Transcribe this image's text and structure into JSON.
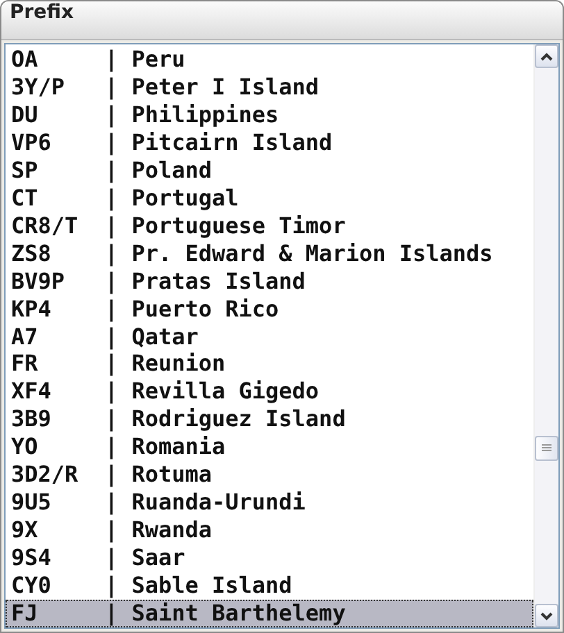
{
  "window": {
    "title": "Prefix"
  },
  "rows": [
    {
      "text": "OA     | Peru",
      "selected": false
    },
    {
      "text": "3Y/P   | Peter I Island",
      "selected": false
    },
    {
      "text": "DU     | Philippines",
      "selected": false
    },
    {
      "text": "VP6    | Pitcairn Island",
      "selected": false
    },
    {
      "text": "SP     | Poland",
      "selected": false
    },
    {
      "text": "CT     | Portugal",
      "selected": false
    },
    {
      "text": "CR8/T  | Portuguese Timor",
      "selected": false
    },
    {
      "text": "ZS8    | Pr. Edward & Marion Islands",
      "selected": false
    },
    {
      "text": "BV9P   | Pratas Island",
      "selected": false
    },
    {
      "text": "KP4    | Puerto Rico",
      "selected": false
    },
    {
      "text": "A7     | Qatar",
      "selected": false
    },
    {
      "text": "FR     | Reunion",
      "selected": false
    },
    {
      "text": "XF4    | Revilla Gigedo",
      "selected": false
    },
    {
      "text": "3B9    | Rodriguez Island",
      "selected": false
    },
    {
      "text": "YO     | Romania",
      "selected": false
    },
    {
      "text": "3D2/R  | Rotuma",
      "selected": false
    },
    {
      "text": "9U5    | Ruanda-Urundi",
      "selected": false
    },
    {
      "text": "9X     | Rwanda",
      "selected": false
    },
    {
      "text": "9S4    | Saar",
      "selected": false
    },
    {
      "text": "CY0    | Sable Island",
      "selected": false
    },
    {
      "text": "FJ     | Saint Barthelemy",
      "selected": true
    }
  ]
}
